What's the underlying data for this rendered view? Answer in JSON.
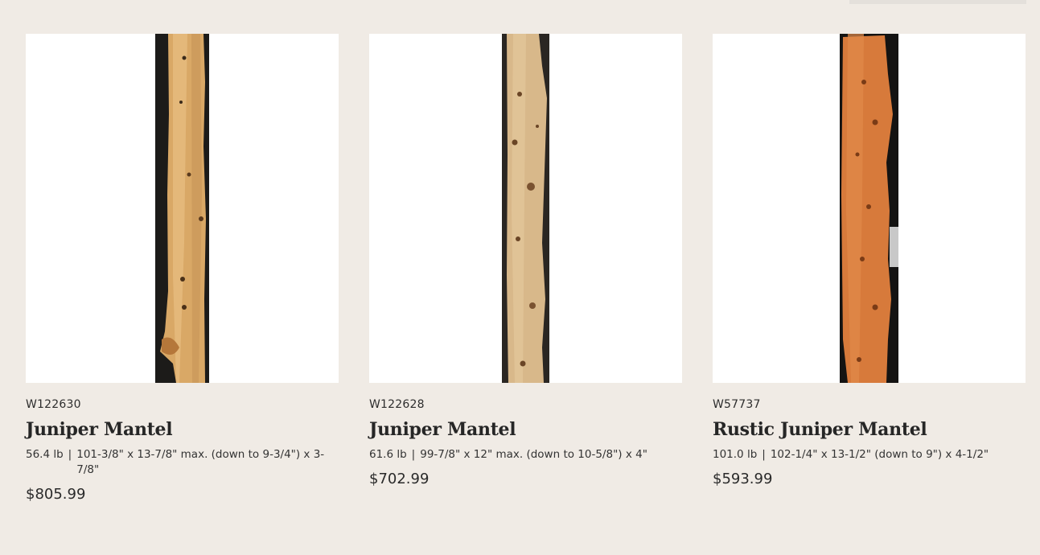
{
  "products": [
    {
      "sku": "W122630",
      "title": "Juniper Mantel",
      "weight": "56.4 lb",
      "separator": "|",
      "dimensions": "101-3/8\" x 13-7/8\" max. (down to 9-3/4\") x 3-7/8\"",
      "price": "$805.99"
    },
    {
      "sku": "W122628",
      "title": "Juniper Mantel",
      "weight": "61.6 lb",
      "separator": "|",
      "dimensions": "99-7/8\" x 12\" max. (down to 10-5/8\") x 4\"",
      "price": "$702.99"
    },
    {
      "sku": "W57737",
      "title": "Rustic Juniper Mantel",
      "weight": "101.0 lb",
      "separator": "|",
      "dimensions": "102-1/4\" x 13-1/2\" (down to 9\") x 4-1/2\"",
      "price": "$593.99"
    }
  ]
}
